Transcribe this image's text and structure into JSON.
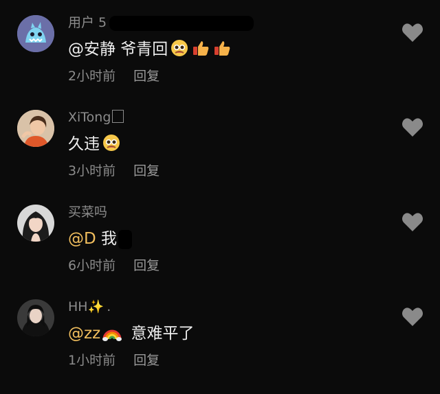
{
  "comments": [
    {
      "username": "用户 5",
      "username_redacted": true,
      "avatar_icon": "blue-monster-avatar",
      "content": {
        "mention": "",
        "text": "@安静 爷青回",
        "emojis": [
          "pleading-face-icon",
          "thumbs-up-icon",
          "thumbs-up-icon"
        ]
      },
      "time": "2小时前",
      "reply_label": "回复"
    },
    {
      "username": "XiTong",
      "username_suffix_glyph": "box-glyph",
      "avatar_icon": "girl-orange-shirt-avatar",
      "content": {
        "mention": "",
        "text": "久违",
        "emojis": [
          "pleading-face-icon"
        ]
      },
      "time": "3小时前",
      "reply_label": "回复"
    },
    {
      "username": "买菜吗",
      "avatar_icon": "girl-dark-hair-avatar",
      "content": {
        "mention": "@D",
        "text": "我",
        "text_redacted_after": true,
        "emojis": []
      },
      "time": "6小时前",
      "reply_label": "回复"
    },
    {
      "username": "HH",
      "username_sparkle": "✨",
      "username_suffix": ".",
      "avatar_icon": "girl-black-hoodie-avatar",
      "content": {
        "mention": "@zz",
        "mention_emoji": "rainbow-icon",
        "text": "意难平了",
        "emojis": []
      },
      "time": "1小时前",
      "reply_label": "回复"
    }
  ],
  "colors": {
    "background": "#0b0b0b",
    "text": "#ededed",
    "secondary_text": "#8c8c8c",
    "mention": "#f2bf5e",
    "like_icon": "#8a8a8a"
  }
}
